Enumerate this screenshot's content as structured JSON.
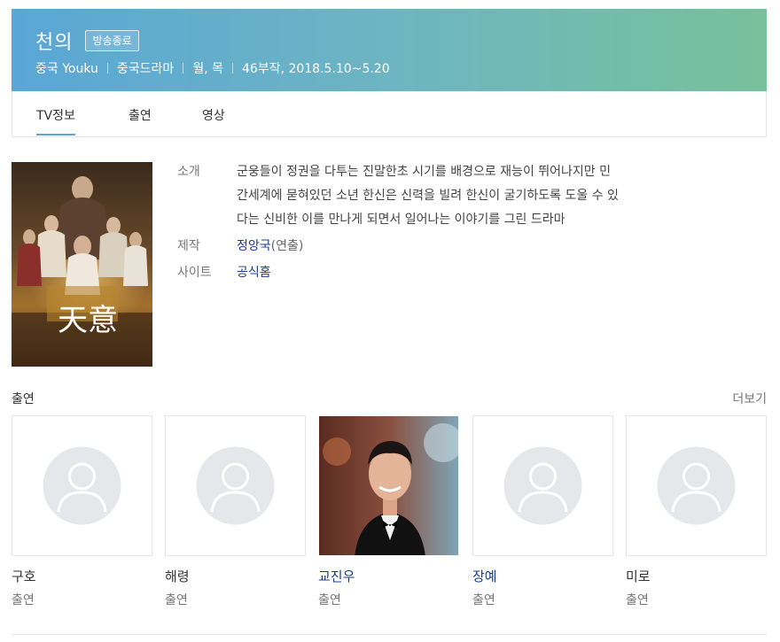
{
  "header": {
    "title": "천의",
    "status_badge": "방송종료",
    "meta": [
      "중국 Youku",
      "중국드라마",
      "월, 목",
      "46부작, 2018.5.10~5.20"
    ]
  },
  "tabs": [
    {
      "label": "TV정보",
      "active": true
    },
    {
      "label": "출연",
      "active": false
    },
    {
      "label": "영상",
      "active": false
    }
  ],
  "info": {
    "synopsis_key": "소개",
    "synopsis_lines": [
      "군웅들이 정권을 다투는 진말한초 시기를 배경으로 재능이 뛰어나지만 민",
      "간세계에 묻혀있던 소년 한신은 신력을 빌려 한신이 굴기하도록 도울 수 있",
      "다는 신비한 이를 만나게 되면서 일어나는 이야기를 그린 드라마"
    ],
    "production_key": "제작",
    "production_name": "정앙국",
    "production_role": "(연출)",
    "site_key": "사이트",
    "site_link": "공식홈"
  },
  "poster_text": "天意",
  "cast": {
    "title": "출연",
    "more": "더보기",
    "members": [
      {
        "name": "구호",
        "role": "출연",
        "has_photo": false,
        "linked": false
      },
      {
        "name": "해령",
        "role": "출연",
        "has_photo": false,
        "linked": false
      },
      {
        "name": "교진우",
        "role": "출연",
        "has_photo": true,
        "linked": true
      },
      {
        "name": "장예",
        "role": "출연",
        "has_photo": false,
        "linked": true
      },
      {
        "name": "미로",
        "role": "출연",
        "has_photo": false,
        "linked": false
      }
    ]
  },
  "colors": {
    "header_gradient_start": "#5aa6d6",
    "header_gradient_end": "#78c19b",
    "link": "#1a3b8c"
  }
}
